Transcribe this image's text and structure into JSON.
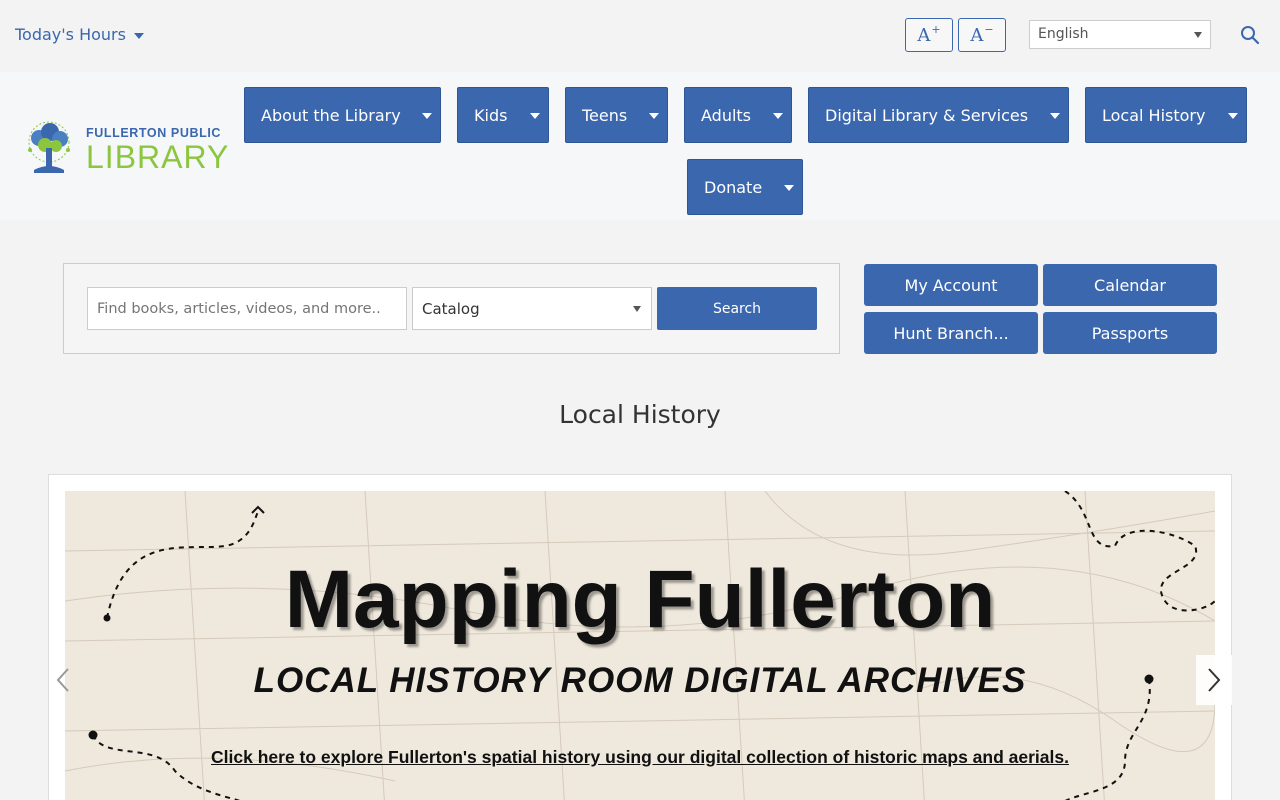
{
  "topbar": {
    "hours_label": "Today's Hours",
    "font_increase": "A",
    "font_decrease": "A",
    "font_increase_sign": "+",
    "font_decrease_sign": "−",
    "language": "English"
  },
  "logo": {
    "line1": "FULLERTON PUBLIC",
    "line2": "LIBRARY"
  },
  "nav": {
    "items": [
      {
        "label": "About the Library"
      },
      {
        "label": "Kids"
      },
      {
        "label": "Teens"
      },
      {
        "label": "Adults"
      },
      {
        "label": "Digital Library & Services"
      },
      {
        "label": "Local History"
      },
      {
        "label": "Donate"
      }
    ]
  },
  "search": {
    "placeholder": "Find books, articles, videos, and more..",
    "scope": "Catalog",
    "button": "Search"
  },
  "quicklinks": {
    "my_account": "My Account",
    "calendar": "Calendar",
    "hunt_branch": "Hunt Branch...",
    "passports": "Passports"
  },
  "page": {
    "title": "Local History"
  },
  "carousel": {
    "title": "Mapping Fullerton",
    "subtitle": "LOCAL HISTORY ROOM DIGITAL ARCHIVES",
    "cta": "Click here to explore Fullerton's spatial history using our digital collection of historic maps and aerials."
  },
  "colors": {
    "primary": "#3a67ad",
    "logo_green": "#8cc63f"
  }
}
